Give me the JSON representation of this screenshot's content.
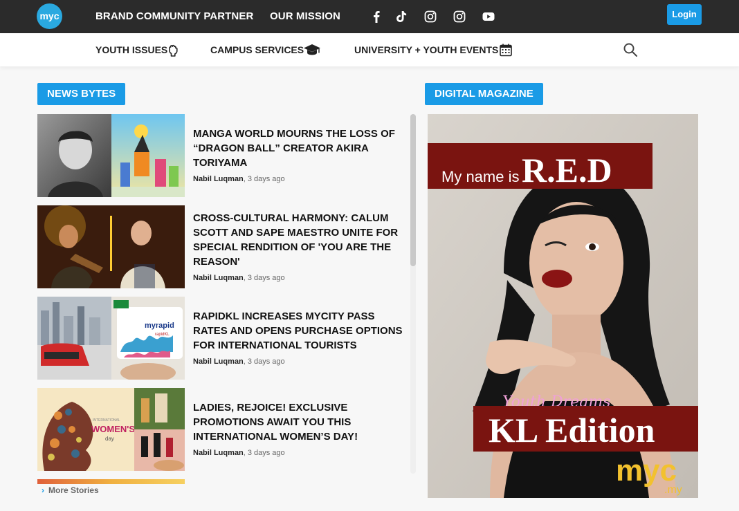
{
  "brand": {
    "logo_text": "myc"
  },
  "topnav": {
    "items": [
      "BRAND COMMUNITY PARTNER",
      "OUR MISSION"
    ]
  },
  "social": {
    "icons": [
      "facebook-icon",
      "tiktok-icon",
      "instagram-icon",
      "instagram-icon",
      "youtube-icon"
    ]
  },
  "login": {
    "label": "Login"
  },
  "subnav": {
    "items": [
      {
        "label": "YOUTH ISSUES",
        "icon": "fist-icon"
      },
      {
        "label": "CAMPUS SERVICES",
        "icon": "graduation-cap-icon"
      },
      {
        "label": "UNIVERSITY + YOUTH EVENTS",
        "icon": "calendar-icon"
      }
    ],
    "search_icon": "search-icon"
  },
  "news": {
    "label": "NEWS BYTES",
    "items": [
      {
        "title": "MANGA WORLD MOURNS THE LOSS OF “DRAGON BALL” CREATOR AKIRA TORIYAMA",
        "author": "Nabil Luqman",
        "time": ", 3 days ago"
      },
      {
        "title": "CROSS-CULTURAL HARMONY: CALUM SCOTT AND SAPE MAESTRO UNITE FOR SPECIAL RENDITION OF 'YOU ARE THE REASON'",
        "author": "Nabil Luqman",
        "time": ", 3 days ago"
      },
      {
        "title": "RAPIDKL INCREASES MYCITY PASS RATES AND OPENS PURCHASE OPTIONS FOR INTERNATIONAL TOURISTS",
        "author": "Nabil Luqman",
        "time": ", 3 days ago"
      },
      {
        "title": "LADIES, REJOICE! EXCLUSIVE PROMOTIONS AWAIT YOU THIS INTERNATIONAL WOMEN’S DAY!",
        "author": "Nabil Luqman",
        "time": ", 3 days ago"
      }
    ],
    "more_label": "More Stories"
  },
  "thumbs": {
    "t3_text": "myrapid",
    "t3_sub": "rapidKL",
    "t4_text": "WOMEN'S",
    "t4_sub": "day",
    "t4_top": "INTERNATIONAL"
  },
  "magazine": {
    "label": "DIGITAL MAGAZINE",
    "line1_small": "My name is",
    "line1_big": "R.E.D",
    "script": "Youth Dreams",
    "edition": "KL Edition",
    "logo": "myc",
    "logo_sub": ".my"
  }
}
